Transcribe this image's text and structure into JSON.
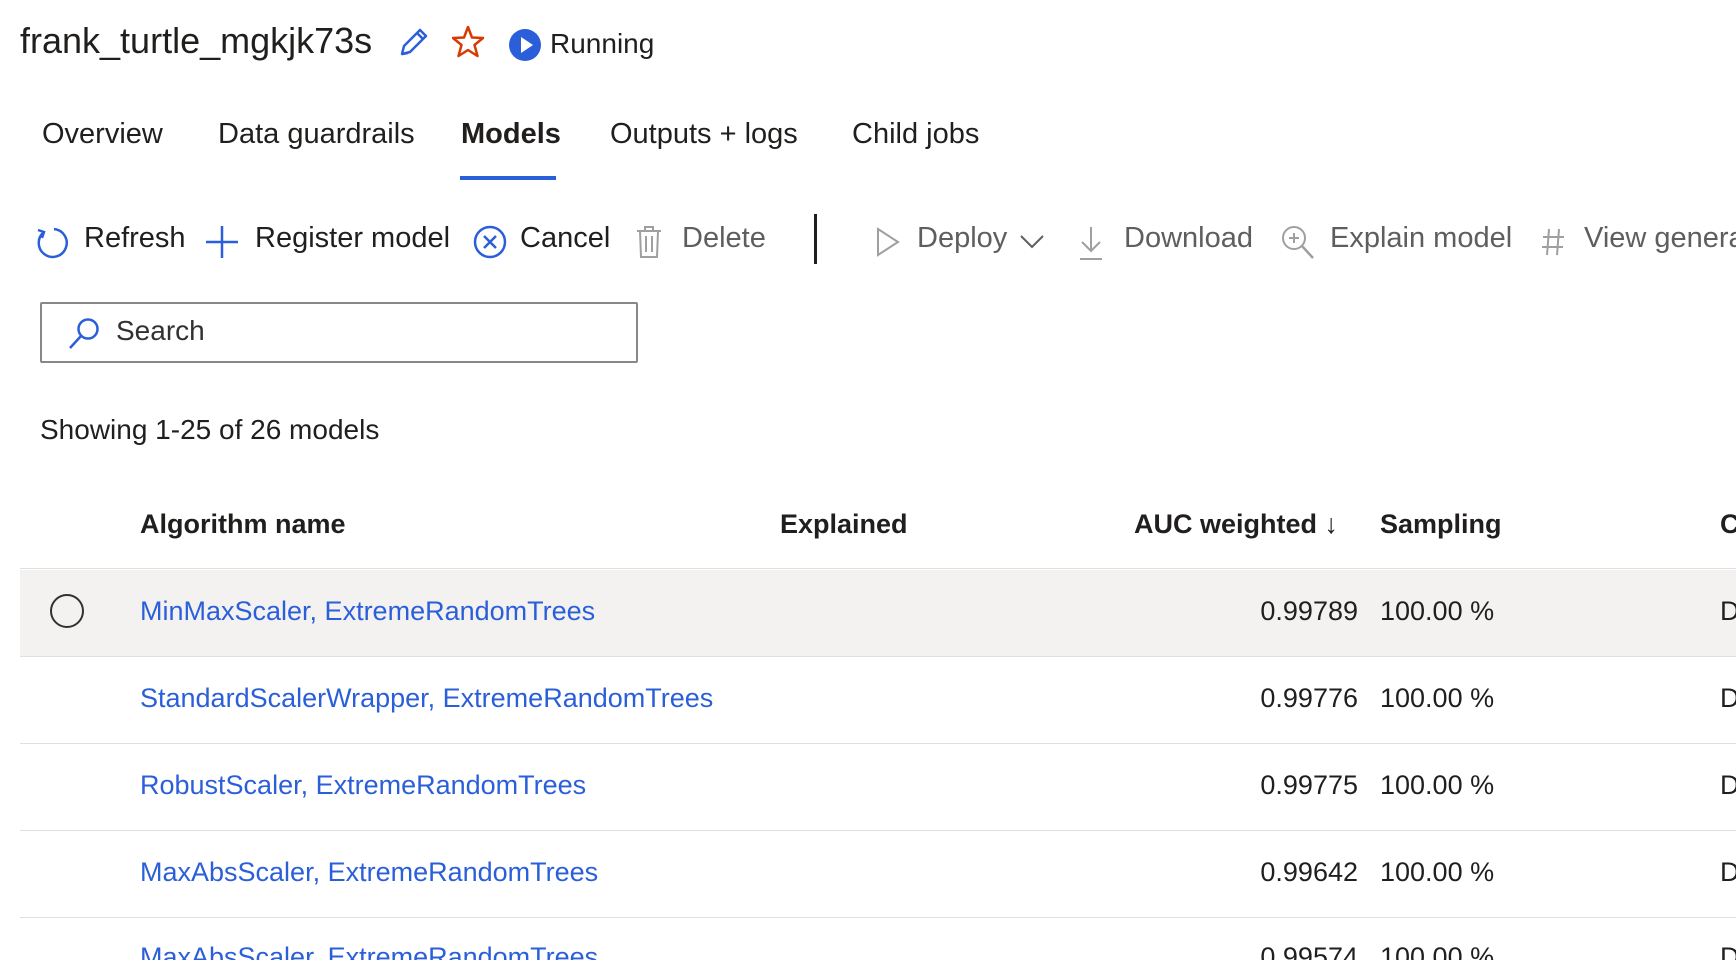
{
  "header": {
    "title": "frank_turtle_mgkjk73s",
    "status": "Running",
    "colors": {
      "accent": "#2b5fd9",
      "star": "#d83b01"
    }
  },
  "tabs": [
    {
      "label": "Overview",
      "active": false
    },
    {
      "label": "Data guardrails",
      "active": false
    },
    {
      "label": "Models",
      "active": true
    },
    {
      "label": "Outputs + logs",
      "active": false
    },
    {
      "label": "Child jobs",
      "active": false
    }
  ],
  "toolbar": {
    "refresh": "Refresh",
    "register": "Register model",
    "cancel": "Cancel",
    "delete": "Delete",
    "deploy": "Deploy",
    "download": "Download",
    "explain": "Explain model",
    "view": "View genera"
  },
  "search": {
    "placeholder": "Search",
    "value": ""
  },
  "showing_text": "Showing 1-25 of 26 models",
  "table": {
    "columns": {
      "algorithm": "Algorithm name",
      "explained": "Explained",
      "auc": "AUC weighted ↓",
      "sampling": "Sampling",
      "last": "C"
    },
    "rows": [
      {
        "algorithm": "MinMaxScaler, ExtremeRandomTrees",
        "explained": "",
        "auc": "0.99789",
        "sampling": "100.00 %",
        "last": "D"
      },
      {
        "algorithm": "StandardScalerWrapper, ExtremeRandomTrees",
        "explained": "",
        "auc": "0.99776",
        "sampling": "100.00 %",
        "last": "D"
      },
      {
        "algorithm": "RobustScaler, ExtremeRandomTrees",
        "explained": "",
        "auc": "0.99775",
        "sampling": "100.00 %",
        "last": "D"
      },
      {
        "algorithm": "MaxAbsScaler, ExtremeRandomTrees",
        "explained": "",
        "auc": "0.99642",
        "sampling": "100.00 %",
        "last": "D"
      },
      {
        "algorithm": "MaxAbsScaler, ExtremeRandomTrees",
        "explained": "",
        "auc": "0.99574",
        "sampling": "100.00 %",
        "last": "D"
      }
    ]
  }
}
